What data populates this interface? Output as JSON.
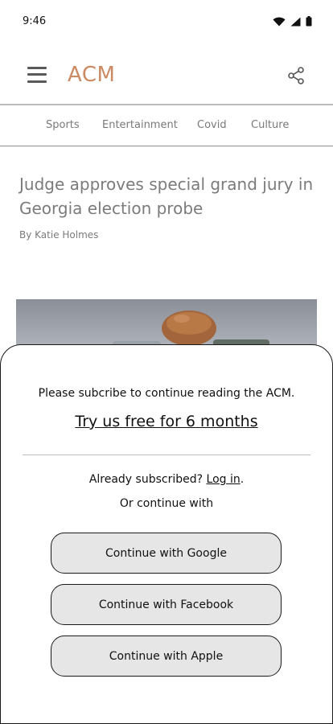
{
  "status_bar": {
    "time": "9:46",
    "icons": [
      "wifi-icon",
      "cellular-signal-icon",
      "battery-icon"
    ]
  },
  "header": {
    "brand": "ACM",
    "brand_color": "#cc8a63",
    "left_icon": "hamburger-menu-icon",
    "right_icon": "share-icon"
  },
  "categories": [
    "Sports",
    "Entertainment",
    "Covid",
    "Culture"
  ],
  "article": {
    "headline": "Judge approves special grand jury in Georgia election probe",
    "byline": "By Katie Holmes",
    "image": "gavel-image"
  },
  "paywall": {
    "prompt": "Please subcribe to continue reading the ACM.",
    "offer": "Try us free for 6 months",
    "already_text": "Already subscribed?",
    "login_label": "Log in",
    "login_suffix": ".",
    "continue_text": "Or continue with",
    "buttons": [
      "Continue with Google",
      "Continue with Facebook",
      "Continue with Apple"
    ]
  }
}
